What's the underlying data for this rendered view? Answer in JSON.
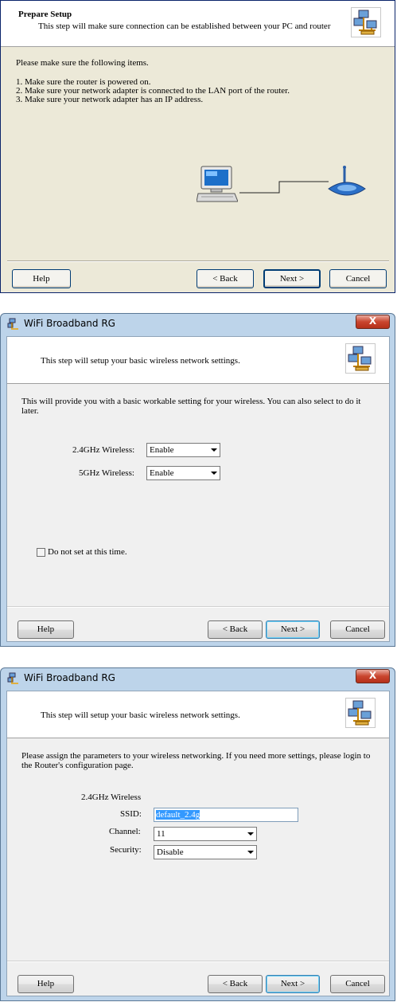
{
  "panel1": {
    "header_title": "Prepare Setup",
    "header_subtitle": "This step will make sure connection can be established between your PC and router",
    "intro": "Please make sure the following items.",
    "items": [
      "1. Make sure the router is powered on.",
      "2. Make sure your network adapter is connected to the LAN port of the router.",
      "3. Make sure your network adapter has an IP address."
    ],
    "buttons": {
      "help": "Help",
      "back": "< Back",
      "next": "Next >",
      "cancel": "Cancel"
    }
  },
  "panel2": {
    "window_title": "WiFi Broadband RG",
    "close_glyph": "X",
    "header_text": "This step will setup your basic wireless network settings.",
    "intro_line1": "This will provide you with a basic workable setting for your wireless. You can also select to do it",
    "intro_line2": "later.",
    "wireless24_label": "2.4GHz Wireless:",
    "wireless24_value": "Enable",
    "wireless5_label": "5GHz Wireless:",
    "wireless5_value": "Enable",
    "checkbox_label": "Do not set at this time.",
    "buttons": {
      "help": "Help",
      "back": "< Back",
      "next": "Next >",
      "cancel": "Cancel"
    }
  },
  "panel3": {
    "window_title": "WiFi Broadband RG",
    "close_glyph": "X",
    "header_text": "This step will setup your basic wireless network settings.",
    "intro_line1": "Please assign the parameters to your wireless networking. If you need more settings, please login to",
    "intro_line2": "the Router's configuration page.",
    "section_label": "2.4GHz Wireless",
    "ssid_label": "SSID:",
    "ssid_value": "default_2.4g",
    "channel_label": "Channel:",
    "channel_value": "11",
    "security_label": "Security:",
    "security_value": "Disable",
    "buttons": {
      "help": "Help",
      "back": "< Back",
      "next": "Next >",
      "cancel": "Cancel"
    }
  }
}
